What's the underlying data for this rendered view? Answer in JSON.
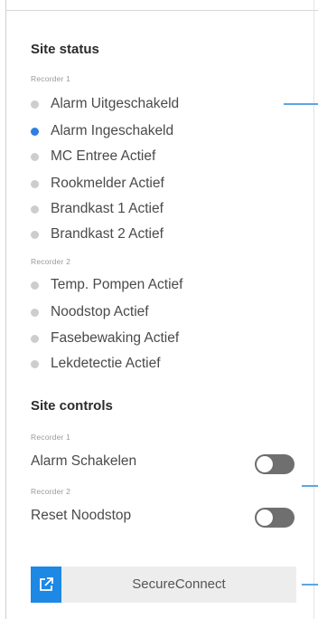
{
  "site_status": {
    "title": "Site status",
    "groups": [
      {
        "recorder": "Recorder 1",
        "items": [
          {
            "label": "Alarm Uitgeschakeld",
            "active": false
          },
          {
            "label": "Alarm Ingeschakeld",
            "active": true
          },
          {
            "label": "MC Entree Actief",
            "active": false
          },
          {
            "label": "Rookmelder Actief",
            "active": false
          },
          {
            "label": "Brandkast 1 Actief",
            "active": false
          },
          {
            "label": "Brandkast 2 Actief",
            "active": false
          }
        ]
      },
      {
        "recorder": "Recorder 2",
        "items": [
          {
            "label": "Temp. Pompen Actief",
            "active": false
          },
          {
            "label": "Noodstop Actief",
            "active": false
          },
          {
            "label": "Fasebewaking Actief",
            "active": false
          },
          {
            "label": "Lekdetectie Actief",
            "active": false
          }
        ]
      }
    ]
  },
  "site_controls": {
    "title": "Site controls",
    "controls": [
      {
        "recorder": "Recorder 1",
        "label": "Alarm Schakelen",
        "on": false
      },
      {
        "recorder": "Recorder 2",
        "label": "Reset Noodstop",
        "on": false
      }
    ]
  },
  "secure_connect": {
    "label": "SecureConnect",
    "icon": "external-link-icon"
  },
  "colors": {
    "active_dot": "#2f7fe0",
    "inactive_dot": "#cdcdcd",
    "toggle_off": "#6f6f6f",
    "connect_icon_bg": "#1e88e5",
    "connector_line": "#5ba6e6"
  }
}
